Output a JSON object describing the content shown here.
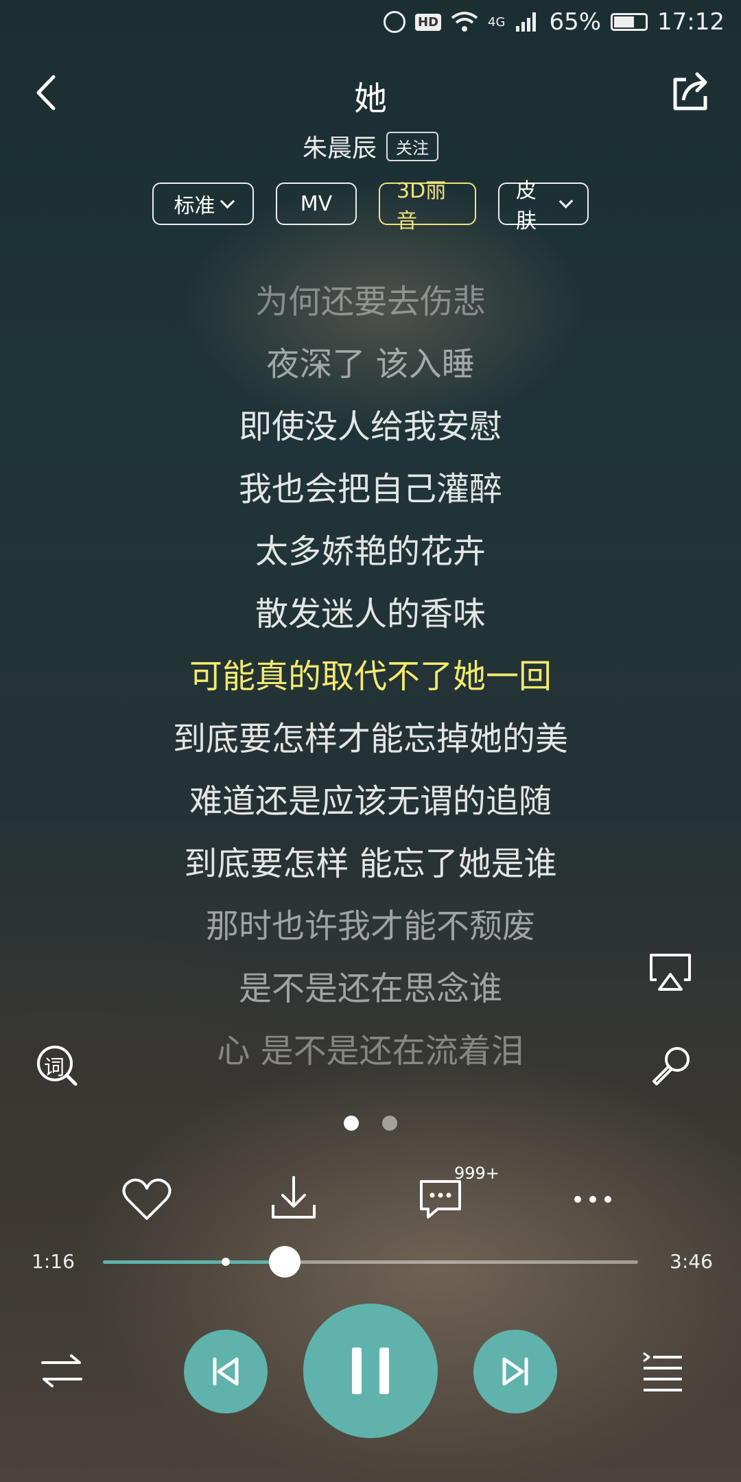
{
  "status_bar": {
    "battery": "65%",
    "time": "17:12",
    "network": "4G"
  },
  "header": {
    "title": "她",
    "artist": "朱晨辰",
    "follow_label": "关注"
  },
  "chips": [
    {
      "label": "标准",
      "dropdown": true
    },
    {
      "label": "MV",
      "dropdown": false
    },
    {
      "label": "3D丽音",
      "dropdown": false,
      "accent": "#f2e47a"
    },
    {
      "label": "皮肤",
      "dropdown": true
    }
  ],
  "lyrics": [
    {
      "text": "为何还要去伤悲",
      "state": "dim2"
    },
    {
      "text": "夜深了 该入睡",
      "state": "dim1"
    },
    {
      "text": "即使没人给我安慰",
      "state": "normal"
    },
    {
      "text": "我也会把自己灌醉",
      "state": "normal"
    },
    {
      "text": "太多娇艳的花卉",
      "state": "normal"
    },
    {
      "text": "散发迷人的香味",
      "state": "normal"
    },
    {
      "text": "可能真的取代不了她一回",
      "state": "active"
    },
    {
      "text": "到底要怎样才能忘掉她的美",
      "state": "normal"
    },
    {
      "text": "难道还是应该无谓的追随",
      "state": "normal"
    },
    {
      "text": "到底要怎样 能忘了她是谁",
      "state": "normal"
    },
    {
      "text": "那时也许我才能不颓废",
      "state": "dim1"
    },
    {
      "text": "是不是还在思念谁",
      "state": "dim1"
    },
    {
      "text": "心 是不是还在流着泪",
      "state": "dim2"
    }
  ],
  "side_icons": {
    "lyrics_button_label": "词"
  },
  "page_indicator": {
    "count": 2,
    "active_index": 0
  },
  "actions": {
    "comment_count": "999+"
  },
  "player": {
    "elapsed": "1:16",
    "duration": "3:46",
    "progress": 0.34,
    "buffered": 0.23,
    "accent": "#5fb3ac"
  }
}
